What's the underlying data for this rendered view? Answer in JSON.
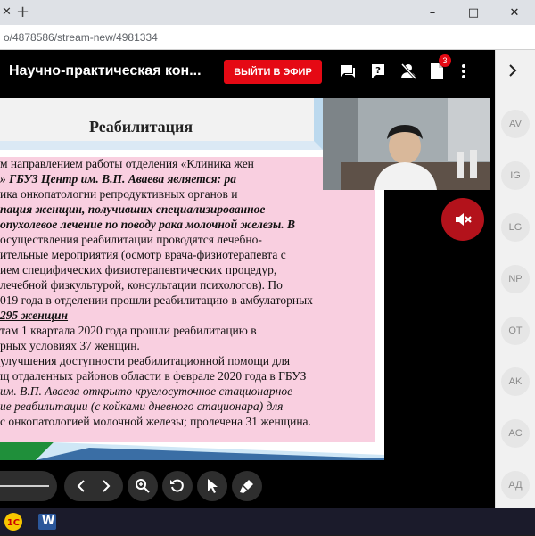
{
  "browser": {
    "url": "o/4878586/stream-new/4981334",
    "tab_close_glyph": "✕",
    "new_tab_glyph": "+",
    "window_controls": [
      "–",
      "□",
      "✕"
    ]
  },
  "appbar": {
    "title": "Научно-практическая кон...",
    "live_button_label": "ВЫЙТИ В ЭФИР",
    "icons": [
      "chat-icon",
      "question-icon",
      "user-off-icon",
      "document-icon",
      "more-vert-icon"
    ],
    "notification_count": "3"
  },
  "slide": {
    "title": "Реабилитация",
    "lines": [
      "м направлением    работы отделения «Клиника жен",
      "»  ГБУЗ Центр    им. В.П. Аваева  является:  ра",
      "ика  онкопатологии   репродуктивных   органов    и",
      "пация   женщин,    получивших    специализированное",
      "опухолевое лечение по поводу рака молочной железы.  В",
      "   осуществления    реабилитации    проводятся    лечебно-",
      "ительные   мероприятия   (осмотр   врача-физиотерапевта   с",
      "ием   специфических   физиотерапевтических   процедур,",
      "лечебной физкультурой, консультации психологов).     По",
      "019 года в отделении прошли реабилитацию в амбулаторных",
      "295 женщин",
      "там   1   квартала   2020   года   прошли   реабилитацию   в",
      "рных условиях 37 женщин.",
      "   улучшения доступности реабилитационной помощи для",
      "щ отдаленных районов области  в феврале 2020 года в ГБУЗ",
      "им. В.П. Аваева открыто   круглосуточное стационарное",
      "ие реабилитации (с койками дневного стационара) для",
      "с онкопатологией молочной железы; пролечена 31 женщина."
    ]
  },
  "controls": {
    "icons": [
      "prev-icon",
      "next-icon",
      "zoom-icon",
      "rotate-icon",
      "pointer-icon",
      "brush-icon"
    ]
  },
  "participants": [
    "AV",
    "IG",
    "LG",
    "NP",
    "OT",
    "AK",
    "AC",
    "АД"
  ],
  "taskbar": {
    "items": [
      "1c-icon",
      "word-icon"
    ],
    "word_letter": "W"
  },
  "colors": {
    "accent_red": "#e50914",
    "mute_red": "#b3121b",
    "slide_pink": "#f9cfe0"
  }
}
